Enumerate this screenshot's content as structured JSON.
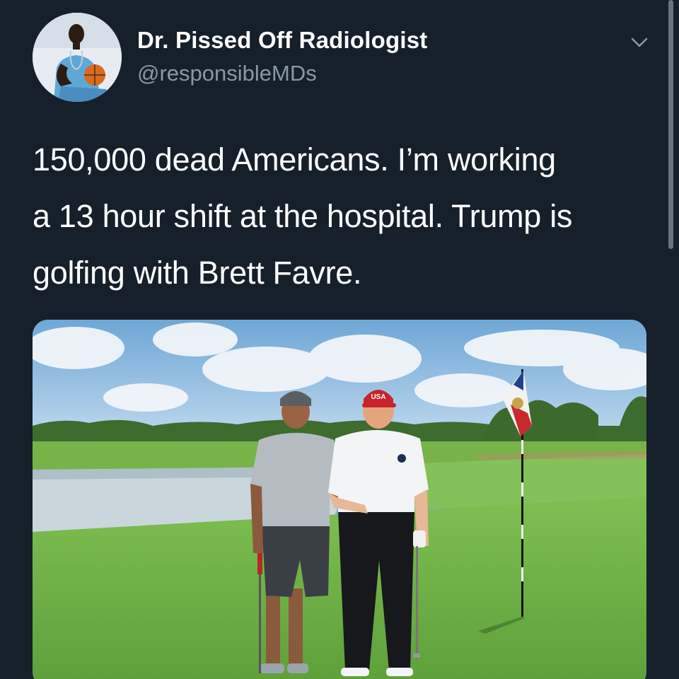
{
  "tweet": {
    "display_name": "Dr. Pissed Off Radiologist",
    "handle": "@responsibleMDs",
    "text_lines": [
      "150,000 dead Americans. I’m working",
      "a 13 hour shift at the hospital. Trump is",
      "golfing with Brett Favre."
    ],
    "media_cap_text": "USA"
  },
  "icons": {
    "avatar": "user-avatar",
    "menu": "chevron-down-icon"
  },
  "colors": {
    "background": "#15202b",
    "secondary_text": "#8899a6",
    "primary_text": "#ffffff"
  }
}
